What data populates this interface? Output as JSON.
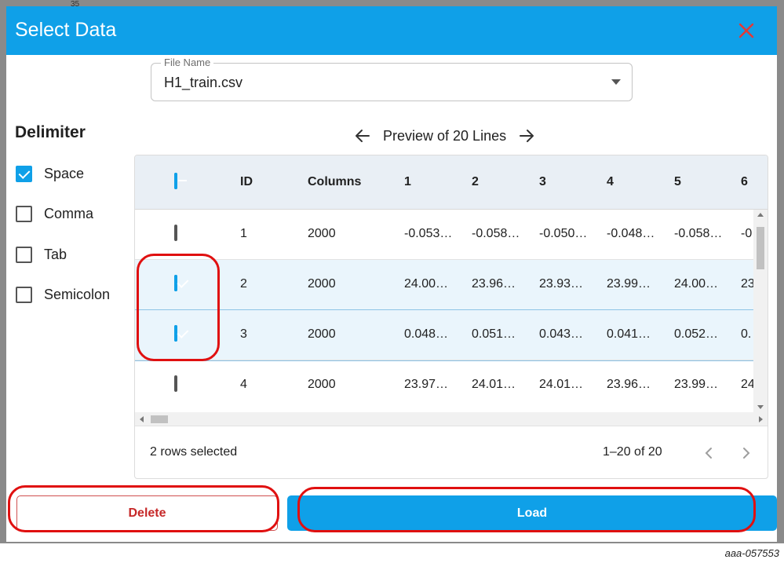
{
  "backdrop": {
    "axis_tick": "35"
  },
  "dialog": {
    "title": "Select Data"
  },
  "file_field": {
    "label": "File Name",
    "value": "H1_train.csv"
  },
  "delimiter": {
    "title": "Delimiter",
    "options": [
      {
        "label": "Space",
        "checked": true
      },
      {
        "label": "Comma",
        "checked": false
      },
      {
        "label": "Tab",
        "checked": false
      },
      {
        "label": "Semicolon",
        "checked": false
      }
    ]
  },
  "preview": {
    "title": "Preview of 20 Lines"
  },
  "table": {
    "headers": [
      "ID",
      "Columns",
      "1",
      "2",
      "3",
      "4",
      "5",
      "6"
    ],
    "rows": [
      {
        "selected": false,
        "cells": [
          "1",
          "2000",
          "-0.053…",
          "-0.058…",
          "-0.050…",
          "-0.048…",
          "-0.058…",
          "-0"
        ]
      },
      {
        "selected": true,
        "cells": [
          "2",
          "2000",
          "24.00…",
          "23.96…",
          "23.93…",
          "23.99…",
          "24.00…",
          "23"
        ]
      },
      {
        "selected": true,
        "cells": [
          "3",
          "2000",
          "0.048…",
          "0.051…",
          "0.043…",
          "0.041…",
          "0.052…",
          "0."
        ]
      },
      {
        "selected": false,
        "cells": [
          "4",
          "2000",
          "23.97…",
          "24.01…",
          "24.01…",
          "23.96…",
          "23.99…",
          "24"
        ]
      }
    ],
    "footer": {
      "selection": "2 rows selected",
      "range": "1–20 of 20"
    }
  },
  "actions": {
    "delete_label": "Delete",
    "load_label": "Load"
  },
  "colors": {
    "accent": "#0fa0e8",
    "danger": "#c62828",
    "highlight_mark": "#e01010"
  },
  "caption": "aaa-057553"
}
